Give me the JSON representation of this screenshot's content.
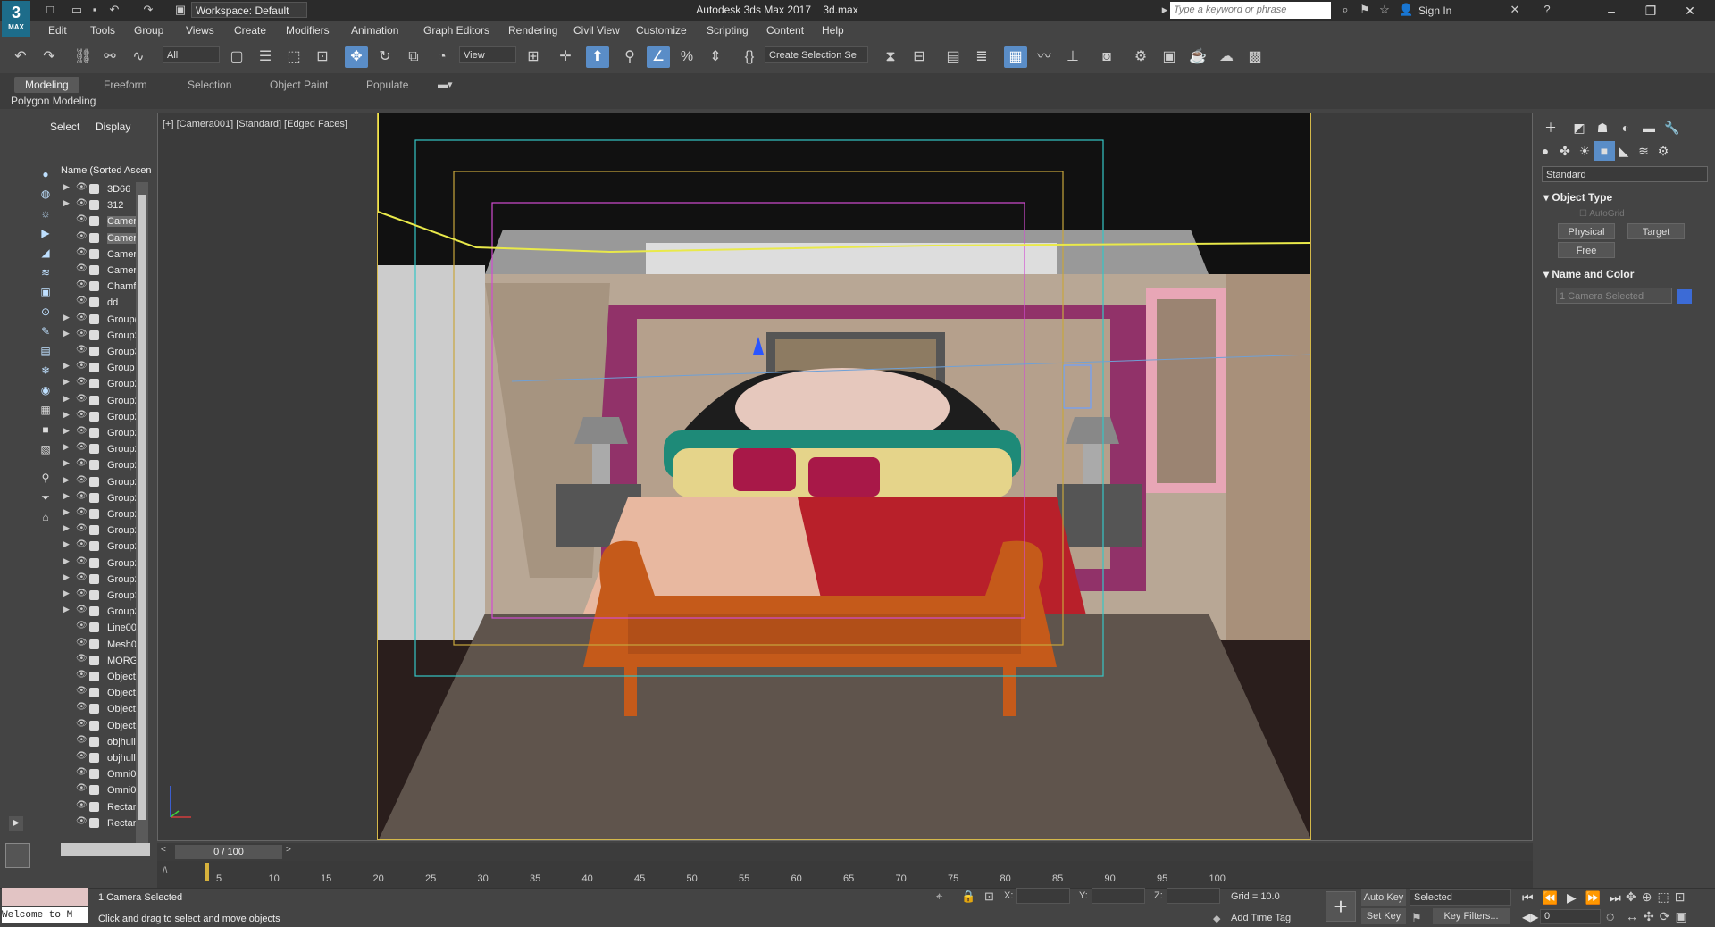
{
  "app": {
    "logo_text": "3",
    "logo_sub": "MAX",
    "window_title": "Autodesk 3ds Max 2017",
    "file_name": "3d.max",
    "workspace_label": "Workspace: Default",
    "search_placeholder": "Type a keyword or phrase",
    "sign_in": "Sign In"
  },
  "menu": [
    "Edit",
    "Tools",
    "Group",
    "Views",
    "Create",
    "Modifiers",
    "Animation",
    "Graph Editors",
    "Rendering",
    "Civil View",
    "Customize",
    "Scripting",
    "Content",
    "Help"
  ],
  "toolbar": {
    "filter_value": "All",
    "ref_coord": "View",
    "selection_set": "Create Selection Se"
  },
  "ribbon": {
    "tabs": [
      "Modeling",
      "Freeform",
      "Selection",
      "Object Paint",
      "Populate"
    ],
    "active_tab": "Modeling",
    "panel_label": "Polygon Modeling"
  },
  "explorer": {
    "tab_select": "Select",
    "tab_display": "Display",
    "column_header": "Name (Sorted Ascen",
    "rows": [
      {
        "name": "3D66",
        "expandable": true,
        "selected": false
      },
      {
        "name": "312",
        "expandable": true,
        "selected": false
      },
      {
        "name": "Camer",
        "expandable": false,
        "selected": true
      },
      {
        "name": "Camer",
        "expandable": false,
        "selected": true
      },
      {
        "name": "Camer",
        "expandable": false,
        "selected": false
      },
      {
        "name": "Camer",
        "expandable": false,
        "selected": false
      },
      {
        "name": "Chamf",
        "expandable": false,
        "selected": false
      },
      {
        "name": "dd",
        "expandable": false,
        "selected": false
      },
      {
        "name": "Group(",
        "expandable": true,
        "selected": false
      },
      {
        "name": "Group2",
        "expandable": true,
        "selected": false
      },
      {
        "name": "Group3",
        "expandable": false,
        "selected": false
      },
      {
        "name": "Group",
        "expandable": true,
        "selected": false
      },
      {
        "name": "Group2",
        "expandable": true,
        "selected": false
      },
      {
        "name": "Group2",
        "expandable": true,
        "selected": false
      },
      {
        "name": "Group2",
        "expandable": true,
        "selected": false
      },
      {
        "name": "Group2",
        "expandable": true,
        "selected": false
      },
      {
        "name": "Group2",
        "expandable": true,
        "selected": false
      },
      {
        "name": "Group2",
        "expandable": true,
        "selected": false
      },
      {
        "name": "Group2",
        "expandable": true,
        "selected": false
      },
      {
        "name": "Group2",
        "expandable": true,
        "selected": false
      },
      {
        "name": "Group2",
        "expandable": true,
        "selected": false
      },
      {
        "name": "Group2",
        "expandable": true,
        "selected": false
      },
      {
        "name": "Group2",
        "expandable": true,
        "selected": false
      },
      {
        "name": "Group2",
        "expandable": true,
        "selected": false
      },
      {
        "name": "Group2",
        "expandable": true,
        "selected": false
      },
      {
        "name": "Group3",
        "expandable": true,
        "selected": false
      },
      {
        "name": "Group3",
        "expandable": true,
        "selected": false
      },
      {
        "name": "Line00",
        "expandable": false,
        "selected": false
      },
      {
        "name": "Mesh0",
        "expandable": false,
        "selected": false
      },
      {
        "name": "MORG",
        "expandable": false,
        "selected": false
      },
      {
        "name": "Object",
        "expandable": false,
        "selected": false
      },
      {
        "name": "Object",
        "expandable": false,
        "selected": false
      },
      {
        "name": "Object",
        "expandable": false,
        "selected": false
      },
      {
        "name": "Object",
        "expandable": false,
        "selected": false
      },
      {
        "name": "objhull",
        "expandable": false,
        "selected": false
      },
      {
        "name": "objhull",
        "expandable": false,
        "selected": false
      },
      {
        "name": "Omni0",
        "expandable": false,
        "selected": false
      },
      {
        "name": "Omni0",
        "expandable": false,
        "selected": false
      },
      {
        "name": "Rectan",
        "expandable": false,
        "selected": false
      },
      {
        "name": "Rectan",
        "expandable": false,
        "selected": false
      }
    ]
  },
  "viewport": {
    "label": "[+] [Camera001] [Standard] [Edged Faces]"
  },
  "command_panel": {
    "category_dropdown": "Standard",
    "object_type_title": "Object Type",
    "autogrid_label": "AutoGrid",
    "buttons": [
      "Physical",
      "Target",
      "Free"
    ],
    "name_color_title": "Name and Color",
    "name_field": "1 Camera Selected",
    "object_color": "#3c6bd6"
  },
  "timeline": {
    "frame_counter": "0 / 100",
    "ticks": [
      "5",
      "10",
      "15",
      "20",
      "25",
      "30",
      "35",
      "40",
      "45",
      "50",
      "55",
      "60",
      "65",
      "70",
      "75",
      "80",
      "85",
      "90",
      "95",
      "100"
    ]
  },
  "status": {
    "listener_text": "Welcome to M",
    "selection_info": "1 Camera Selected",
    "prompt": "Click and drag to select and move objects",
    "x_label": "X:",
    "y_label": "Y:",
    "z_label": "Z:",
    "grid": "Grid = 10.0",
    "add_time_tag": "Add Time Tag",
    "auto_key": "Auto Key",
    "set_key": "Set Key",
    "key_mode": "Selected",
    "key_filters": "Key Filters...",
    "frame_value": "0"
  }
}
